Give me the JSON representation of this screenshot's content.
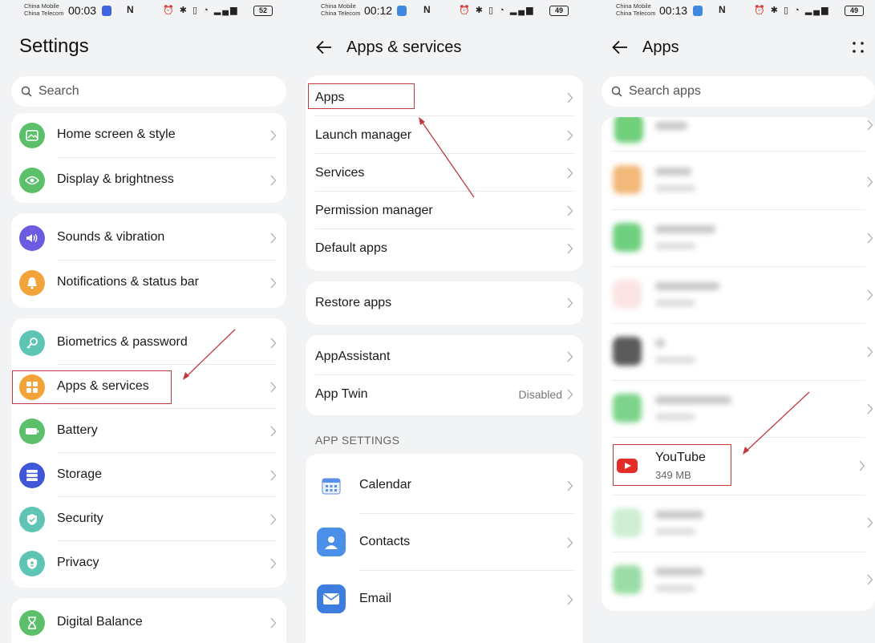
{
  "screens": [
    {
      "status": {
        "carrier1": "China Mobile",
        "carrier2": "China Telecom",
        "time": "00:03",
        "battery": "52"
      },
      "title": "Settings",
      "search_placeholder": "Search",
      "groups": [
        [
          {
            "label": "Home screen & style",
            "icon": "home-screen-icon",
            "color": "#5cbf6a"
          },
          {
            "label": "Display & brightness",
            "icon": "eye-icon",
            "color": "#5cbf6a"
          }
        ],
        [
          {
            "label": "Sounds & vibration",
            "icon": "speaker-icon",
            "color": "#6b5be0"
          },
          {
            "label": "Notifications & status bar",
            "icon": "bell-icon",
            "color": "#f2a33a"
          }
        ],
        [
          {
            "label": "Biometrics & password",
            "icon": "key-icon",
            "color": "#5ec5b5"
          },
          {
            "label": "Apps & services",
            "icon": "apps-grid-icon",
            "color": "#f2a33a"
          },
          {
            "label": "Battery",
            "icon": "battery-icon",
            "color": "#5cbf6a"
          },
          {
            "label": "Storage",
            "icon": "storage-icon",
            "color": "#3f57d6"
          },
          {
            "label": "Security",
            "icon": "shield-icon",
            "color": "#5ec5b5"
          },
          {
            "label": "Privacy",
            "icon": "privacy-shield-icon",
            "color": "#5ec5b5"
          }
        ],
        [
          {
            "label": "Digital Balance",
            "icon": "hourglass-icon",
            "color": "#5cbf6a"
          }
        ]
      ]
    },
    {
      "status": {
        "carrier1": "China Mobile",
        "carrier2": "China Telecom",
        "time": "00:12",
        "battery": "49"
      },
      "title": "Apps & services",
      "groups": [
        [
          {
            "label": "Apps"
          },
          {
            "label": "Launch manager"
          },
          {
            "label": "Services"
          },
          {
            "label": "Permission manager"
          },
          {
            "label": "Default apps"
          }
        ],
        [
          {
            "label": "Restore apps"
          }
        ],
        [
          {
            "label": "AppAssistant"
          },
          {
            "label": "App Twin",
            "value": "Disabled"
          }
        ]
      ],
      "section_title": "APP SETTINGS",
      "app_settings": [
        {
          "label": "Calendar",
          "icon": "calendar-icon"
        },
        {
          "label": "Contacts",
          "icon": "contacts-icon"
        },
        {
          "label": "Email",
          "icon": "email-icon"
        }
      ]
    },
    {
      "status": {
        "carrier1": "China Mobile",
        "carrier2": "China Telecom",
        "time": "00:13",
        "battery": "49"
      },
      "title": "Apps",
      "search_placeholder": "Search apps",
      "featured_app": {
        "name": "YouTube",
        "size": "349 MB",
        "icon": "youtube-icon",
        "color": "#e52d27"
      }
    }
  ],
  "colors": {
    "highlight": "#c0393f",
    "background": "#f1f3f5",
    "card": "#ffffff"
  }
}
